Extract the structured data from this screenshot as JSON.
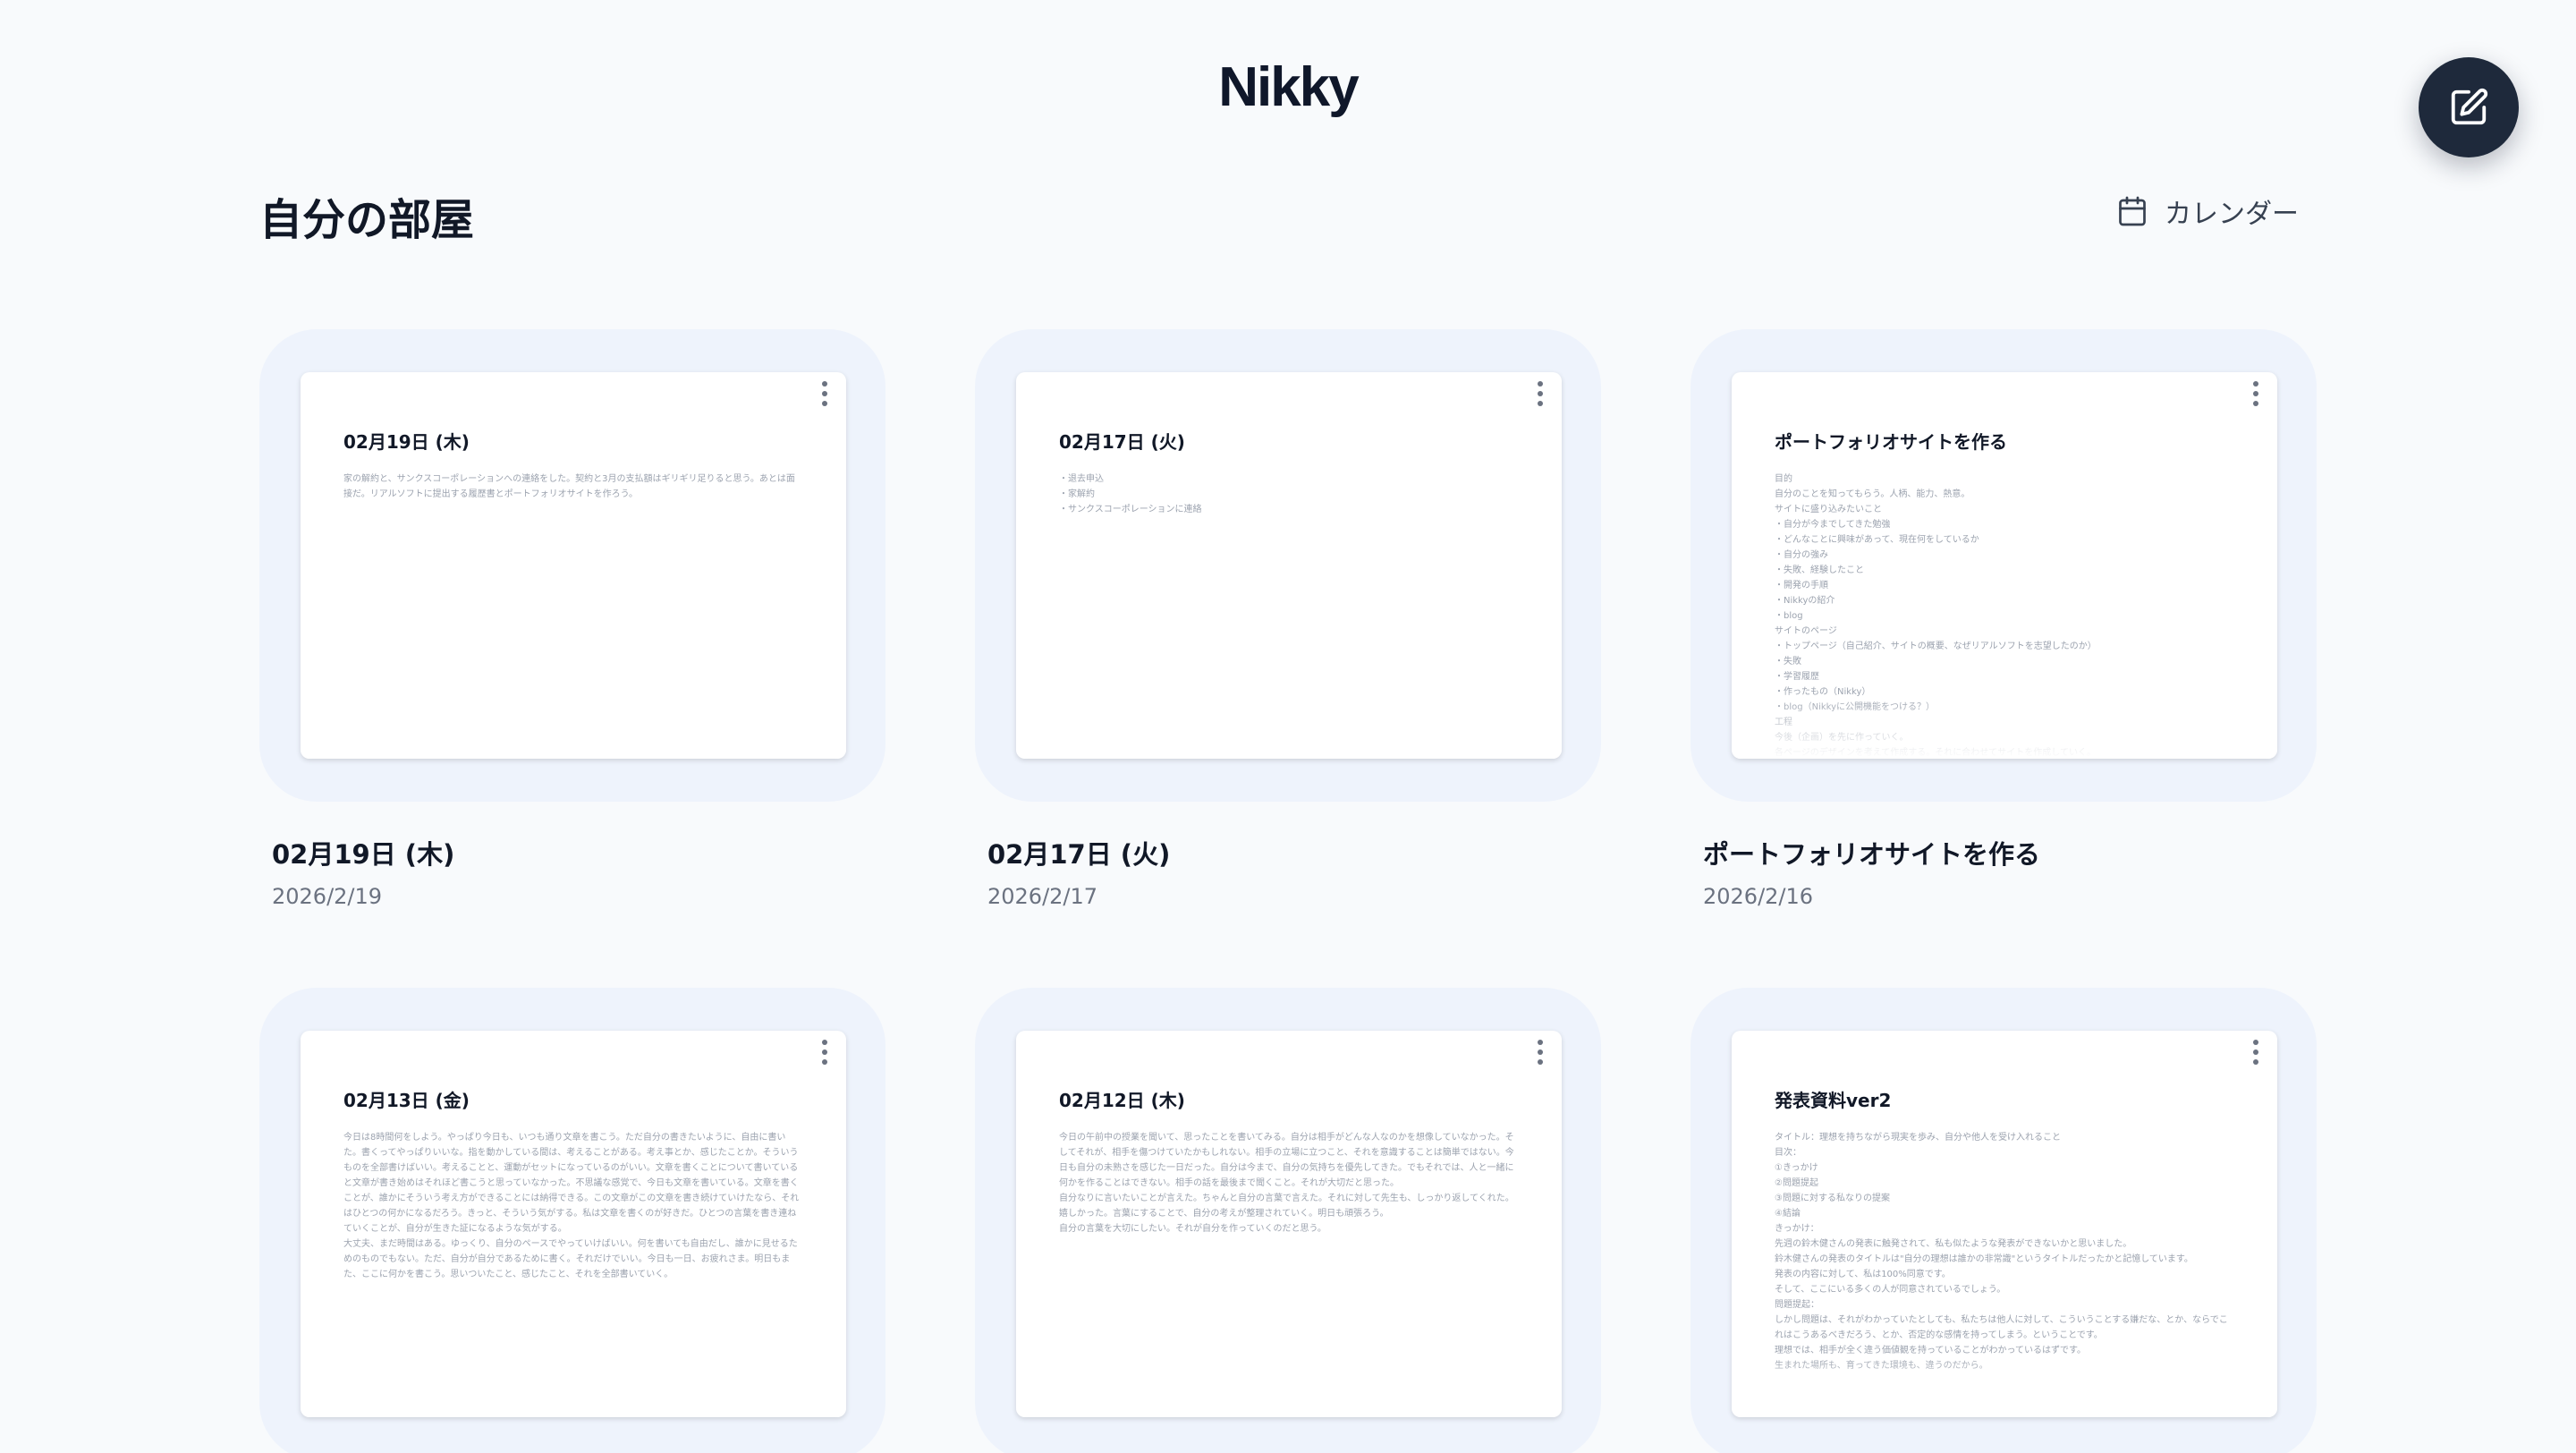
{
  "app": {
    "logo": "Nikky"
  },
  "header": {
    "page_title": "自分の部屋",
    "calendar_label": "カレンダー"
  },
  "cards": [
    {
      "title": "02月19日 (木)",
      "date": "2026/2/19",
      "body": "家の解約と、サンクスコーポレーションへの連絡をした。契約と3月の支払額はギリギリ足りると思う。あとは面接だ。リアルソフトに提出する履歴書とポートフォリオサイトを作ろう。"
    },
    {
      "title": "02月17日 (火)",
      "date": "2026/2/17",
      "body": "・退去申込\n・家解約\n・サンクスコーポレーションに連絡"
    },
    {
      "title": "ポートフォリオサイトを作る",
      "date": "2026/2/16",
      "body": "目的\n自分のことを知ってもらう。人柄、能力、熱意。\nサイトに盛り込みたいこと\n・自分が今までしてきた勉強\n・どんなことに興味があって、現在何をしているか\n・自分の強み\n・失敗、経験したこと\n・開発の手順\n・Nikkyの紹介\n・blog\nサイトのページ\n・トップページ（自己紹介、サイトの概要、なぜリアルソフトを志望したのか）\n・失敗\n・学習履歴\n・作ったもの（Nikky）\n・blog（Nikkyに公開機能をつける？）\n工程\n今後（企画）を先に作っていく。\n各ページのデザインを考えて作成する。それに合わせてサイトを作成していく。"
    },
    {
      "title": "02月13日 (金)",
      "date": "",
      "body": "今日は8時間何をしよう。やっぱり今日も、いつも通り文章を書こう。ただ自分の書きたいように、自由に書いた。書くってやっぱりいいな。指を動かしている間は、考えることがある。考え事とか、感じたことか。そういうものを全部書けばいい。考えることと、運動がセットになっているのがいい。文章を書くことについて書いていると文章が書き始めはそれほど書こうと思っていなかった。不思議な感覚で、今日も文章を書いている。文章を書くことが、誰かにそういう考え方ができることには納得できる。この文章がこの文章を書き続けていけたなら、それはひとつの何かになるだろう。きっと、そういう気がする。私は文章を書くのが好きだ。ひとつの言葉を書き連ねていくことが、自分が生きた証になるような気がする。\n大丈夫、まだ時間はある。ゆっくり、自分のペースでやっていけばいい。何を書いても自由だし、誰かに見せるためのものでもない。ただ、自分が自分であるために書く。それだけでいい。今日も一日、お疲れさま。明日もまた、ここに何かを書こう。思いついたこと、感じたこと、それを全部書いていく。"
    },
    {
      "title": "02月12日 (木)",
      "date": "",
      "body": "今日の午前中の授業を聞いて、思ったことを書いてみる。自分は相手がどんな人なのかを想像していなかった。そしてそれが、相手を傷つけていたかもしれない。相手の立場に立つこと、それを意識することは簡単ではない。今日も自分の未熟さを感じた一日だった。自分は今まで、自分の気持ちを優先してきた。でもそれでは、人と一緒に何かを作ることはできない。相手の話を最後まで聞くこと。それが大切だと思った。\n自分なりに言いたいことが言えた。ちゃんと自分の言葉で言えた。それに対して先生も、しっかり返してくれた。嬉しかった。言葉にすることで、自分の考えが整理されていく。明日も頑張ろう。\n自分の言葉を大切にしたい。それが自分を作っていくのだと思う。"
    },
    {
      "title": "発表資料ver2",
      "date": "",
      "body": "タイトル：理想を持ちながら現実を歩み、自分や他人を受け入れること\n目次：\n①きっかけ\n②問題提起\n③問題に対する私なりの提案\n④結論\nきっかけ：\n先週の鈴木健さんの発表に触発されて、私も似たような発表ができないかと思いました。\n鈴木健さんの発表のタイトルは\"自分の理想は誰かの非常識\"というタイトルだったかと記憶しています。\n発表の内容に対して、私は100%同意です。\nそして、ここにいる多くの人が同意されているでしょう。\n問題提起：\nしかし問題は、それがわかっていたとしても、私たちは他人に対して、こういうことする嫌だな、とか、ならでこれはこうあるべきだろう、とか、否定的な感情を持ってしまう。ということです。\n理想では、相手が全く違う価値観を持っていることがわかっているはずです。\n生まれた場所も、育ってきた環境も、違うのだから。"
    }
  ]
}
